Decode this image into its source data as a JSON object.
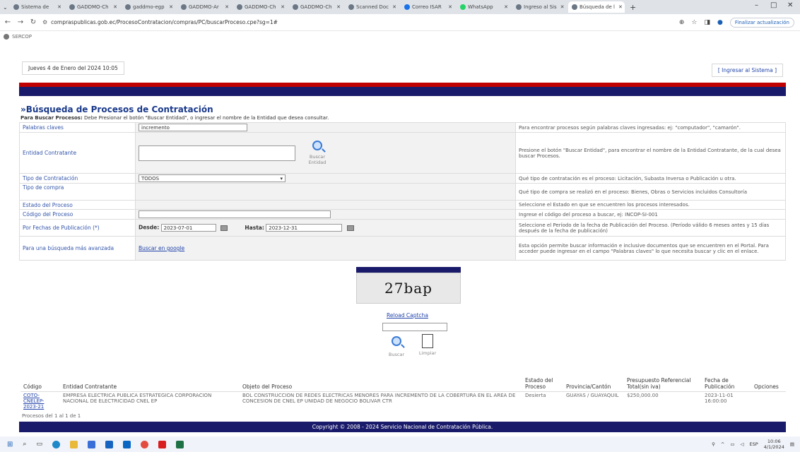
{
  "browser": {
    "tabs": [
      {
        "title": "Sistema de"
      },
      {
        "title": "GADDMO-Ch"
      },
      {
        "title": "gaddmo-egp"
      },
      {
        "title": "GADDMO-Ar"
      },
      {
        "title": "GADDMO-Ch"
      },
      {
        "title": "GADDMO-Ch"
      },
      {
        "title": "Scanned Doc"
      },
      {
        "title": "Correo ISAR"
      },
      {
        "title": "WhatsApp"
      },
      {
        "title": "Ingreso al Sis"
      },
      {
        "title": "Búsqueda de l"
      }
    ],
    "url": "compraspublicas.gob.ec/ProcesoContratacion/compras/PC/buscarProceso.cpe?sg=1#",
    "update_label": "Finalizar actualización",
    "bookmark": "SERCOP"
  },
  "header": {
    "date": "Jueves 4 de Enero del 2024 10:05",
    "login": "[ Ingresar al Sistema ]"
  },
  "search": {
    "title": "»Búsqueda de Procesos de Contratación",
    "intro_bold": "Para Buscar Procesos:",
    "intro_text": " Debe Presionar el botón \"Buscar Entidad\", o ingresar el nombre de la Entidad que desea consultar.",
    "rows": {
      "keywords": {
        "label": "Palabras claves",
        "value": "incremento",
        "help": "Para encontrar procesos según palabras claves ingresadas: ej: \"computador\", \"camarón\"."
      },
      "entity": {
        "label": "Entidad Contratante",
        "button": "Buscar Entidad",
        "help": "Presione el botón \"Buscar Entidad\", para encontrar el nombre de la Entidad Contratante, de la cual desea buscar Procesos."
      },
      "contract_type": {
        "label": "Tipo de Contratación",
        "value": "TODOS",
        "help": "Qué tipo de contratación es el proceso: Licitación, Subasta Inversa o Publicación u otra."
      },
      "purchase_type": {
        "label": "Tipo de compra",
        "help": "Qué tipo de compra se realizó en el proceso: Bienes, Obras o Servicios incluidos Consultoría"
      },
      "status": {
        "label": "Estado del Proceso",
        "help": "Seleccione el Estado en que se encuentren los procesos interesados."
      },
      "code": {
        "label": "Código del Proceso",
        "help": "Ingrese el código del proceso a buscar, ej: INCOP-SI-001"
      },
      "dates": {
        "label": "Por Fechas de Publicación (*)",
        "from_label": "Desde:",
        "from_value": "2023-07-01",
        "to_label": "Hasta:",
        "to_value": "2023-12-31",
        "help": "Seleccione el Período de la fecha de Publicación del Proceso. (Período válido 6 meses antes y 15 días después de la fecha de publicación)"
      },
      "advanced": {
        "label": "Para una búsqueda más avanzada",
        "link": "Buscar en google",
        "help": "Esta opción permite buscar información e inclusive documentos que se encuentren en el Portal. Para acceder puede ingresar en el campo \"Palabras claves\" lo que necesita buscar y clic en el enlace."
      }
    }
  },
  "captcha": {
    "text": "27bap",
    "reload": "Reload Captcha",
    "search_label": "Buscar",
    "clear_label": "Limpiar"
  },
  "results": {
    "headers": [
      "Código",
      "Entidad Contratante",
      "Objeto del Proceso",
      "Estado del Proceso",
      "Provincia/Cantón",
      "Presupuesto Referencial Total(sin iva)",
      "Fecha de Publicación",
      "Opciones"
    ],
    "rows": [
      {
        "code": "COTO-CNELEP-2023-21",
        "entity": "EMPRESA ELECTRICA PUBLICA ESTRATEGICA CORPORACION NACIONAL DE ELECTRICIDAD CNEL EP",
        "object": "BOL CONSTRUCCION DE REDES ELECTRICAS MENORES PARA INCREMENTO DE LA COBERTURA EN EL AREA DE CONCESION DE CNEL EP UNIDAD DE NEGOCIO BOLIVAR CTR",
        "status": "Desierta",
        "province": "GUAYAS / GUAYAQUIL",
        "budget": "$250,000.00",
        "date": "2023-11-01 16:00:00"
      }
    ],
    "summary": "Procesos del 1 al 1 de 1"
  },
  "footer": "Copyright © 2008 - 2024 Servicio Nacional de Contratación Pública.",
  "taskbar": {
    "time": "10:06",
    "date": "4/1/2024"
  }
}
